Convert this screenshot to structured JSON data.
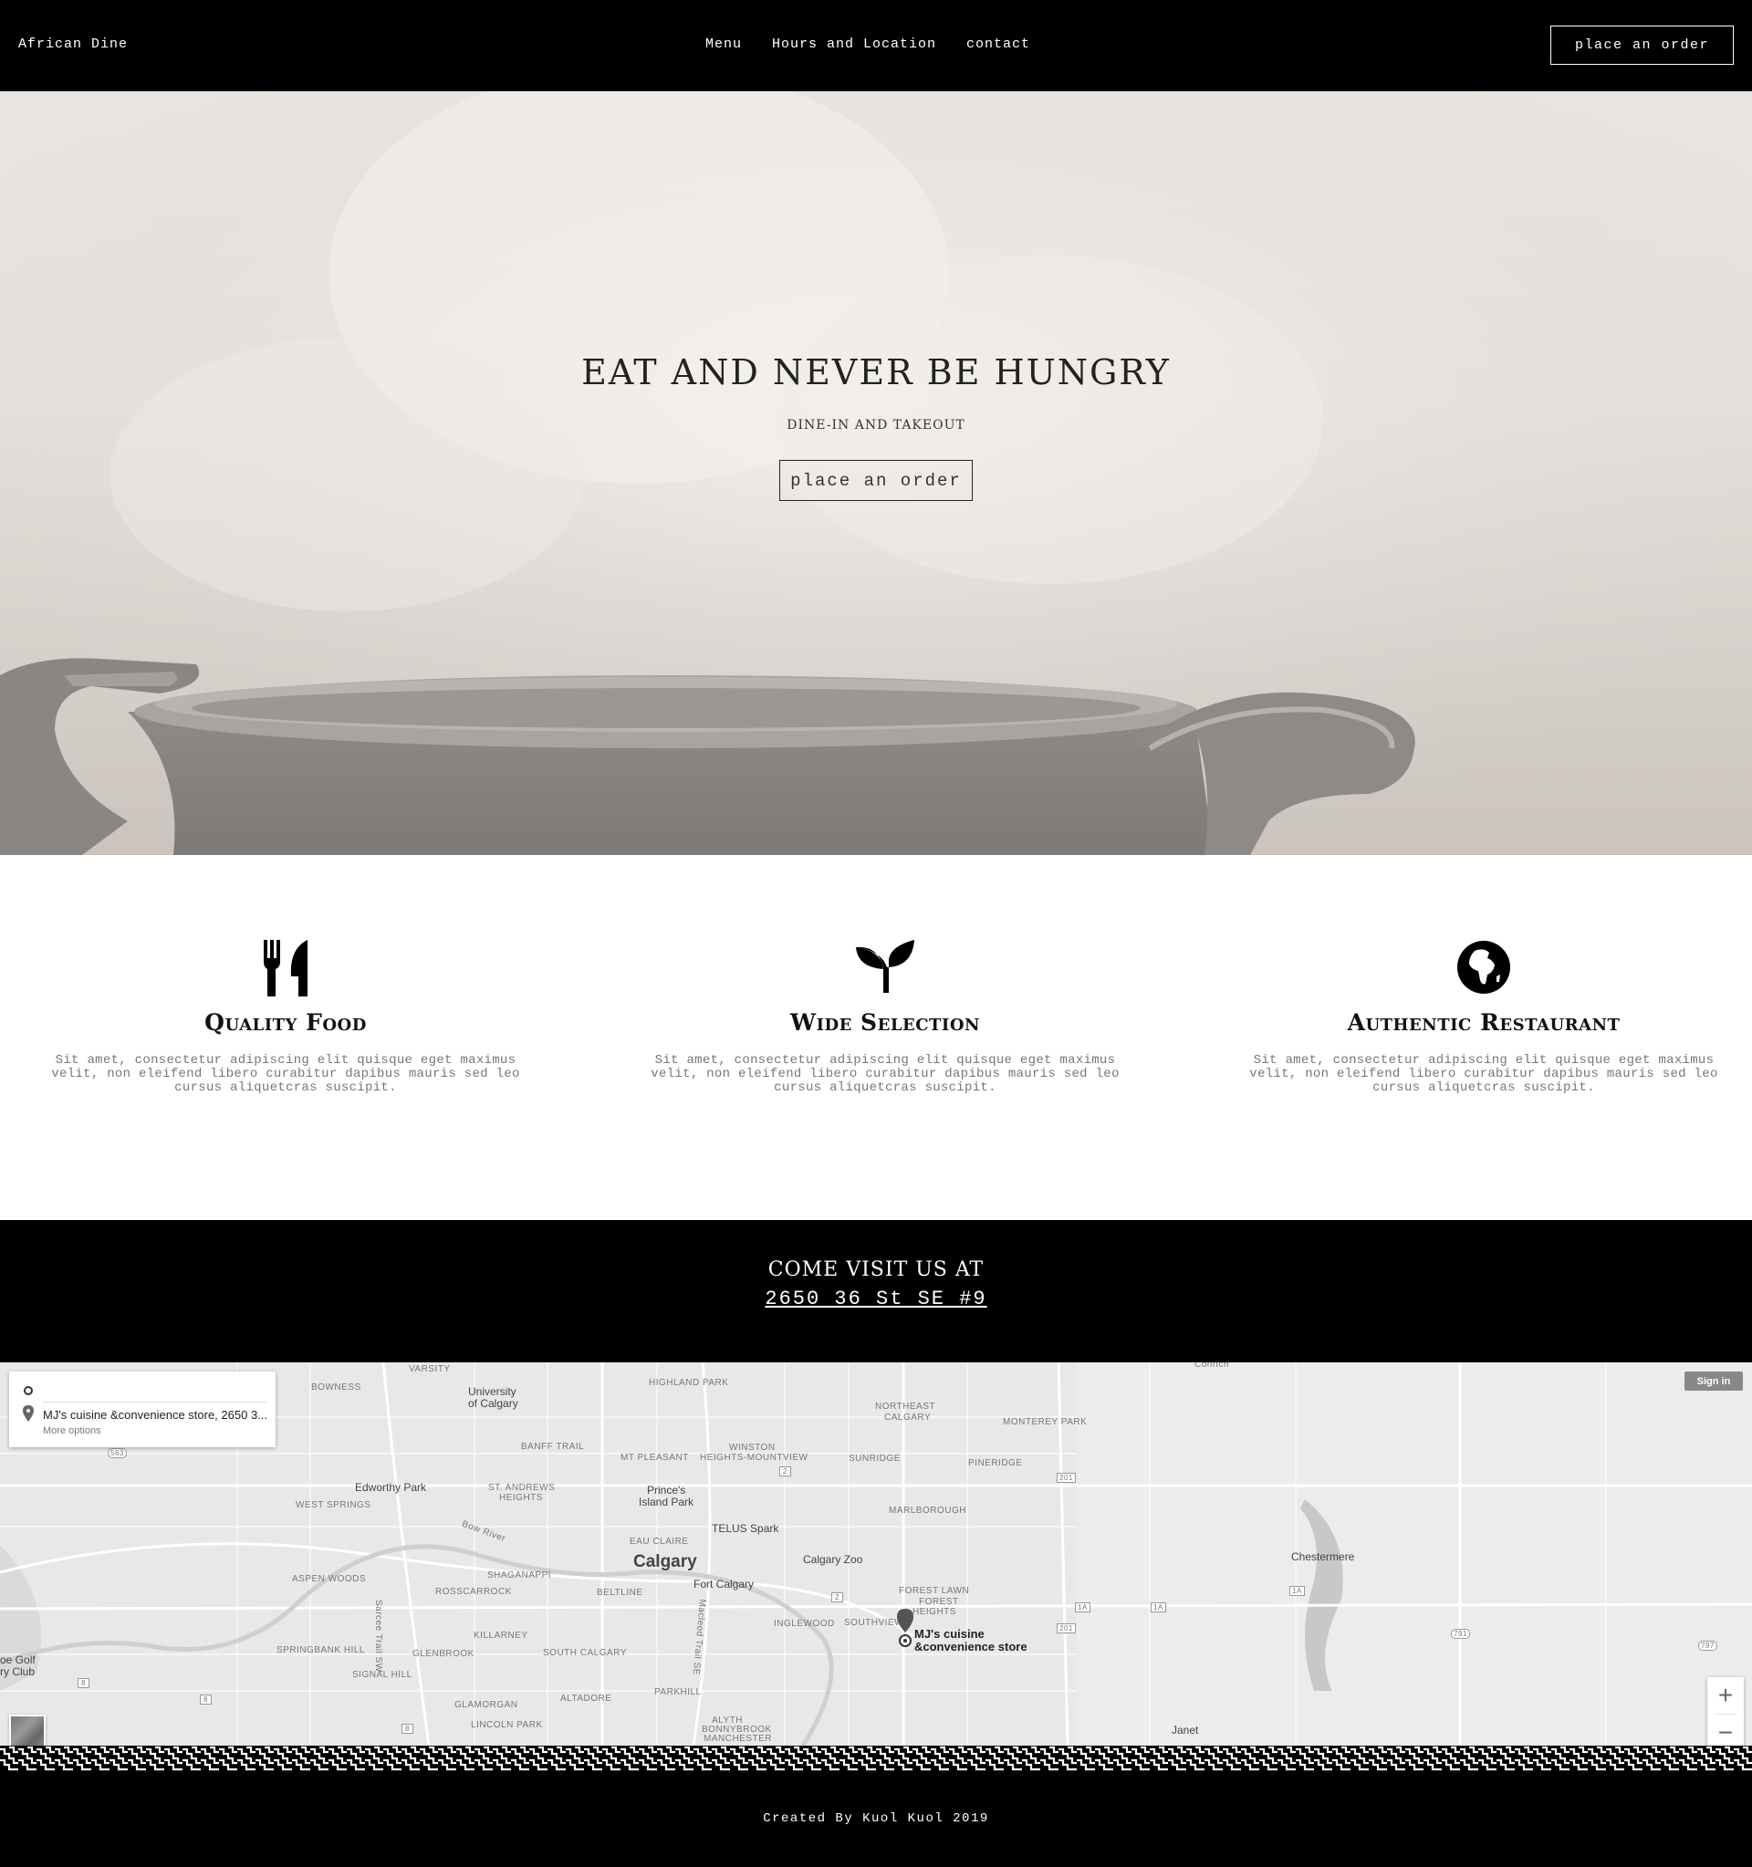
{
  "nav": {
    "brand": "African Dine",
    "links": [
      "Menu",
      "Hours and Location",
      "contact"
    ],
    "order_button": "place an order"
  },
  "hero": {
    "title": "EAT AND NEVER BE HUNGRY",
    "subtitle": "DINE-IN AND TAKEOUT",
    "order_button": "place an order"
  },
  "features": [
    {
      "icon": "utensils-icon",
      "title": "Quality Food",
      "text": "Sit amet, consectetur adipiscing elit quisque eget maximus velit, non eleifend libero curabitur dapibus mauris sed leo cursus aliquetcras suscipit."
    },
    {
      "icon": "seedling-icon",
      "title": "Wide Selection",
      "text": "Sit amet, consectetur adipiscing elit quisque eget maximus velit, non eleifend libero curabitur dapibus mauris sed leo cursus aliquetcras suscipit."
    },
    {
      "icon": "globe-africa-icon",
      "title": "Authentic Restaurant",
      "text": "Sit amet, consectetur adipiscing elit quisque eget maximus velit, non eleifend libero curabitur dapibus mauris sed leo cursus aliquetcras suscipit."
    }
  ],
  "visit": {
    "title": "COME VISIT US AT",
    "address": "2650 36 St SE #9"
  },
  "map": {
    "directions_destination": "MJ's cuisine &convenience store, 2650 3...",
    "more_options": "More options",
    "sign_in": "Sign in",
    "zoom_in": "+",
    "zoom_out": "−",
    "marker_label_line1": "MJ's cuisine",
    "marker_label_line2": "&convenience store",
    "labels": {
      "varsity": "VARSITY",
      "bowness": "BOWNESS",
      "university": "University",
      "of_calgary": "of Calgary",
      "highland_park": "HIGHLAND PARK",
      "northeast": "NORTHEAST",
      "calgary_caps": "CALGARY",
      "monterey_park": "MONTEREY PARK",
      "banff_trail": "BANFF TRAIL",
      "winston": "WINSTON",
      "mt_pleasant": "MT PLEASANT",
      "heights_mountview": "HEIGHTS-MOUNTVIEW",
      "sunridge": "SUNRIDGE",
      "pineridge": "PINERIDGE",
      "edworthy_park": "Edworthy Park",
      "st_andrews": "ST. ANDREWS",
      "heights": "HEIGHTS",
      "princes": "Prince's",
      "island_park": "Island Park",
      "west_springs": "WEST SPRINGS",
      "marlborough": "MARLBOROUGH",
      "telus_spark": "TELUS Spark",
      "bow_river": "Bow River",
      "eau_claire": "EAU CLAIRE",
      "calgary": "Calgary",
      "calgary_zoo": "Calgary Zoo",
      "chestermere": "Chestermere",
      "aspen_woods": "ASPEN WOODS",
      "shaganappi": "SHAGANAPPI",
      "fort_calgary": "Fort Calgary",
      "rosscarrock": "ROSSCARROCK",
      "beltline": "BELTLINE",
      "forest_lawn": "FOREST LAWN",
      "forest": "FOREST",
      "heights2": "HEIGHTS",
      "inglewood": "INGLEWOOD",
      "southview": "SOUTHVIEW",
      "killarney": "KILLARNEY",
      "sarcee_trail": "Sarcee Trail SW",
      "springbank_hill": "SPRINGBANK HILL",
      "glenbrook": "GLENBROOK",
      "south_calgary": "SOUTH CALGARY",
      "macleod_trail": "Macleod Trail SE",
      "golf": "oe Golf",
      "club": "ry Club",
      "signal_hill": "SIGNAL HILL",
      "parkhill": "PARKHILL",
      "altadore": "ALTADORE",
      "glamorgan": "GLAMORGAN",
      "lincoln_park": "LINCOLN PARK",
      "alyth": "ALYTH",
      "bonnybrook": "BONNYBROOK",
      "manchester": "MANCHESTER",
      "janet": "Janet",
      "conrich": "Conrich",
      "r563": "563",
      "r8a": "8",
      "r8b": "8",
      "r8c": "8",
      "r2a": "2",
      "r2b": "2",
      "r201a": "201",
      "r201b": "201",
      "r1a_a": "1A",
      "r1a_b": "1A",
      "r1a_c": "1A",
      "r791": "791",
      "r797": "797"
    }
  },
  "footer": {
    "credit": "Created By Kuol Kuol 2019"
  }
}
